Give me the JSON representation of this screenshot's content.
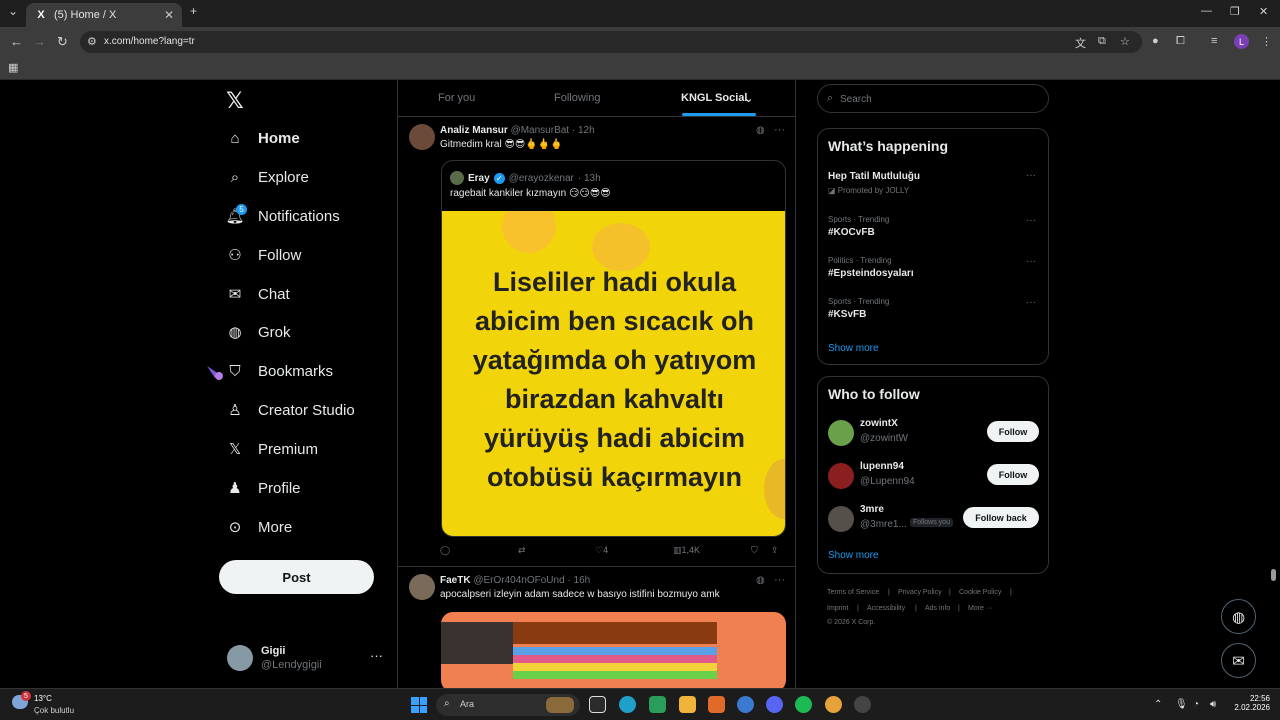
{
  "browser": {
    "tab_title": "(5) Home / X",
    "favicon": "X",
    "url": "x.com/home?lang=tr"
  },
  "left_nav": {
    "items": [
      {
        "label": "Home",
        "icon": "home-icon",
        "active": true
      },
      {
        "label": "Explore",
        "icon": "search-icon"
      },
      {
        "label": "Notifications",
        "icon": "bell-icon",
        "badge": "5"
      },
      {
        "label": "Follow",
        "icon": "person-add-icon"
      },
      {
        "label": "Chat",
        "icon": "mail-icon"
      },
      {
        "label": "Grok",
        "icon": "grok-icon"
      },
      {
        "label": "Bookmarks",
        "icon": "bookmark-icon"
      },
      {
        "label": "Creator Studio",
        "icon": "creator-studio-icon"
      },
      {
        "label": "Premium",
        "icon": "x-premium-icon"
      },
      {
        "label": "Profile",
        "icon": "profile-icon"
      },
      {
        "label": "More",
        "icon": "more-circle-icon"
      }
    ],
    "post_label": "Post",
    "account": {
      "name": "Gigii",
      "handle": "@Lendygigii"
    }
  },
  "feed": {
    "tabs": [
      "For you",
      "Following",
      "KNGL Social"
    ],
    "posts": [
      {
        "name": "Analiz Mansur",
        "handle": "@MansurBat",
        "time": "· 12h",
        "text": "Gitmedim kral 😎😎🖕🖕🖕",
        "quote": {
          "name": "Eray",
          "handle": "@erayozkenar",
          "time": "· 13h",
          "text": "ragebait kankiler kızmayın 😏😏😎😎",
          "image_lines": [
            "Liseliler hadi okula",
            "abicim ben sıcacık oh",
            "yatağımda oh yatıyom",
            "birazdan kahvaltı",
            "yürüyüş hadi abicim",
            "otobüsü kaçırmayın"
          ]
        },
        "likes": "4",
        "views": "1,4K"
      },
      {
        "name": "FaeTK",
        "handle": "@ErOr404nOFoUnd",
        "time": "· 16h",
        "text": "apocalpseri izleyin adam sadece w basıyo istifini bozmuyo amk"
      }
    ]
  },
  "right": {
    "search_placeholder": "Search",
    "happening": {
      "title": "What’s happening",
      "trends": [
        {
          "context": "",
          "name": "Hep Tatil Mutluluğu",
          "promoted": "Promoted by JOLLY"
        },
        {
          "context": "Sports · Trending",
          "name": "#KOCvFB"
        },
        {
          "context": "Politics · Trending",
          "name": "#Epsteindosyaları"
        },
        {
          "context": "Sports · Trending",
          "name": "#KSvFB"
        }
      ],
      "show_more": "Show more"
    },
    "who_to_follow": {
      "title": "Who to follow",
      "users": [
        {
          "name": "zowintX",
          "handle": "@zowintW",
          "button": "Follow",
          "avatar_color": "#6aa04a"
        },
        {
          "name": "lupenn94",
          "handle": "@Lupenn94",
          "button": "Follow",
          "avatar_color": "#8b1e1e"
        },
        {
          "name": "3mre",
          "handle": "@3mre1...",
          "follows_you": "Follows you",
          "button": "Follow back",
          "avatar_color": "#55504a"
        }
      ],
      "show_more": "Show more"
    },
    "footer": [
      "Terms of Service",
      "|",
      "Privacy Policy",
      "|",
      "Cookie Policy",
      "|",
      "Imprint",
      "|",
      "Accessibility",
      "|",
      "Ads info",
      "|",
      "More ···",
      "© 2026 X Corp."
    ]
  },
  "taskbar": {
    "weather_temp": "13°C",
    "weather_desc": "Çok bulutlu",
    "weather_badge": "5",
    "search_placeholder": "Ara",
    "time": "22:56",
    "date": "2.02.2026"
  },
  "colors": {
    "accent": "#1d9bf0",
    "background": "#000000",
    "border": "#2f3336",
    "meme_yellow": "#f2d40a"
  }
}
